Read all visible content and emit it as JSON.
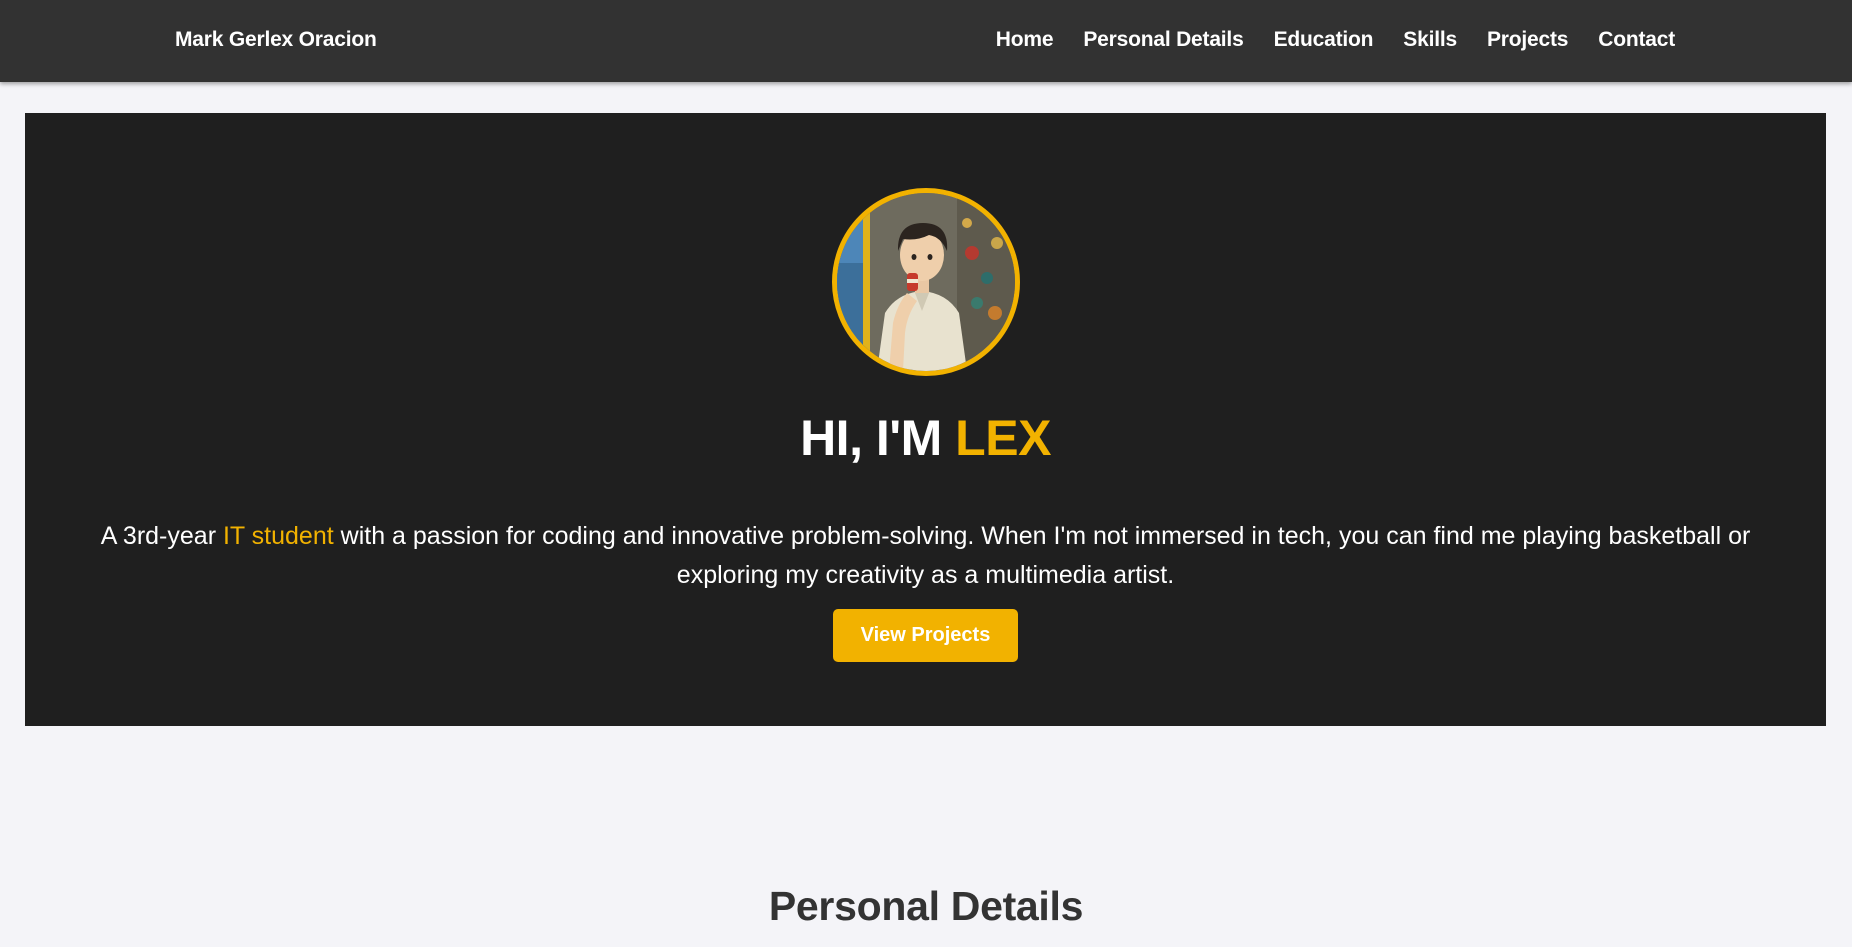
{
  "navbar": {
    "brand": "Mark Gerlex Oracion",
    "links": [
      {
        "label": "Home"
      },
      {
        "label": "Personal Details"
      },
      {
        "label": "Education"
      },
      {
        "label": "Skills"
      },
      {
        "label": "Projects"
      },
      {
        "label": "Contact"
      }
    ]
  },
  "hero": {
    "title_prefix": "HI, I'M ",
    "title_highlight": "LEX",
    "desc_prefix": "A 3rd-year ",
    "desc_highlight": "IT student",
    "desc_suffix": " with a passion for coding and innovative problem-solving. When I'm not immersed in tech, you can find me playing basketball or exploring my creativity as a multimedia artist.",
    "cta_label": "View Projects"
  },
  "sections": {
    "personal_details_title": "Personal Details"
  },
  "colors": {
    "accent": "#f2b200",
    "navbar_bg": "#323232",
    "hero_bg": "#1f1f1f",
    "page_bg": "#f4f4f8"
  }
}
